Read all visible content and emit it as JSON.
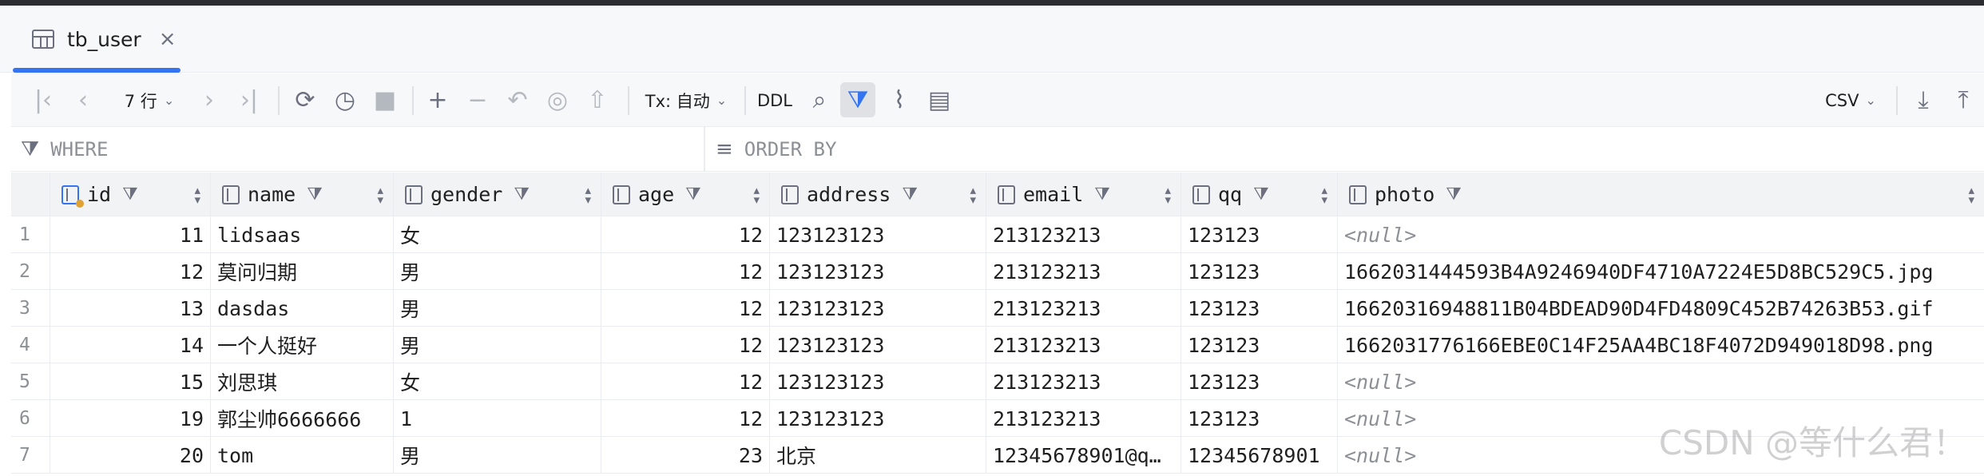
{
  "tab": {
    "label": "tb_user",
    "close": "×"
  },
  "toolbar": {
    "rows_label": "7 行",
    "tx_label": "Tx: 自动",
    "ddl_label": "DDL",
    "export_format": "CSV"
  },
  "filters": {
    "where": "WHERE",
    "order_by": "ORDER BY"
  },
  "columns": [
    {
      "label": "id",
      "key": true
    },
    {
      "label": "name"
    },
    {
      "label": "gender"
    },
    {
      "label": "age"
    },
    {
      "label": "address"
    },
    {
      "label": "email"
    },
    {
      "label": "qq"
    },
    {
      "label": "photo"
    }
  ],
  "rows": [
    {
      "n": "1",
      "id": "11",
      "name": "lidsaas",
      "gender": "女",
      "age": "12",
      "address": "123123123",
      "email": "213123213",
      "qq": "123123",
      "photo": "<null>"
    },
    {
      "n": "2",
      "id": "12",
      "name": "莫问归期",
      "gender": "男",
      "age": "12",
      "address": "123123123",
      "email": "213123213",
      "qq": "123123",
      "photo": "1662031444593B4A9246940DF4710A7224E5D8BC529C5.jpg"
    },
    {
      "n": "3",
      "id": "13",
      "name": "dasdas",
      "gender": "男",
      "age": "12",
      "address": "123123123",
      "email": "213123213",
      "qq": "123123",
      "photo": "16620316948811B04BDEAD90D4FD4809C452B74263B53.gif"
    },
    {
      "n": "4",
      "id": "14",
      "name": "一个人挺好",
      "gender": "男",
      "age": "12",
      "address": "123123123",
      "email": "213123213",
      "qq": "123123",
      "photo": "1662031776166EBE0C14F25AA4BC18F4072D949018D98.png"
    },
    {
      "n": "5",
      "id": "15",
      "name": "刘思琪",
      "gender": "女",
      "age": "12",
      "address": "123123123",
      "email": "213123213",
      "qq": "123123",
      "photo": "<null>"
    },
    {
      "n": "6",
      "id": "19",
      "name": "郭尘帅6666666",
      "gender": "1",
      "age": "12",
      "address": "123123123",
      "email": "213123213",
      "qq": "123123",
      "photo": "<null>"
    },
    {
      "n": "7",
      "id": "20",
      "name": "tom",
      "gender": "男",
      "age": "23",
      "address": "北京",
      "email": "12345678901@q…",
      "qq": "12345678901",
      "photo": "<null>"
    }
  ],
  "watermark": "CSDN @等什么君！"
}
